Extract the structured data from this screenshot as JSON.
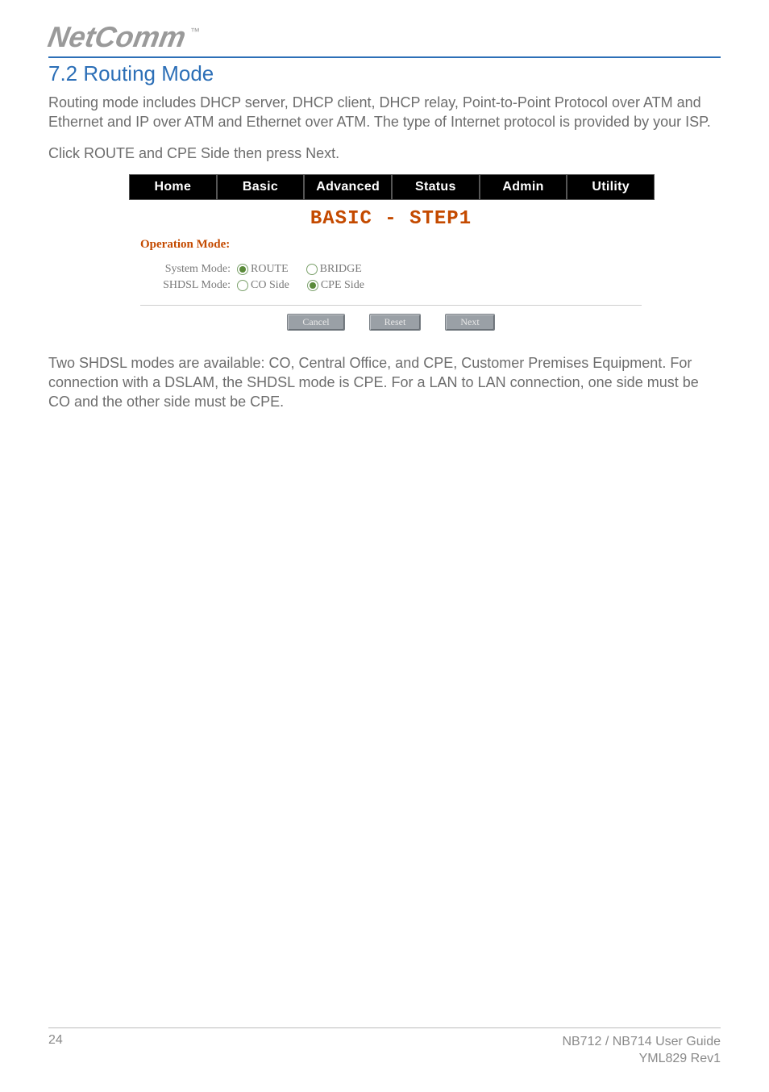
{
  "header": {
    "brand": "NetComm",
    "trademark": "™"
  },
  "section": {
    "title": "7.2 Routing Mode",
    "para1": "Routing mode includes DHCP server, DHCP client, DHCP relay, Point-to-Point Protocol over ATM and Ethernet and IP over ATM and Ethernet over ATM. The type of Internet protocol is provided by your ISP.",
    "para2": "Click ROUTE and CPE Side then press Next.",
    "para3": "Two SHDSL modes are available: CO, Central Office, and CPE, Customer Premises Equipment. For connection with a DSLAM, the SHDSL mode is CPE. For a LAN to LAN connection, one side must be CO and the other side must be CPE."
  },
  "ui": {
    "tabs": [
      "Home",
      "Basic",
      "Advanced",
      "Status",
      "Admin",
      "Utility"
    ],
    "step_title": "BASIC - STEP1",
    "operation_mode_label": "Operation Mode:",
    "rows": {
      "system": {
        "label": "System Mode:",
        "options": [
          "ROUTE",
          "BRIDGE"
        ],
        "selected": "ROUTE"
      },
      "shdsl": {
        "label": "SHDSL Mode:",
        "options": [
          "CO Side",
          "CPE Side"
        ],
        "selected": "CPE Side"
      }
    },
    "buttons": {
      "cancel": "Cancel",
      "reset": "Reset",
      "next": "Next"
    }
  },
  "footer": {
    "page": "24",
    "guide": "NB712 / NB714 User Guide",
    "rev": "YML829 Rev1"
  }
}
